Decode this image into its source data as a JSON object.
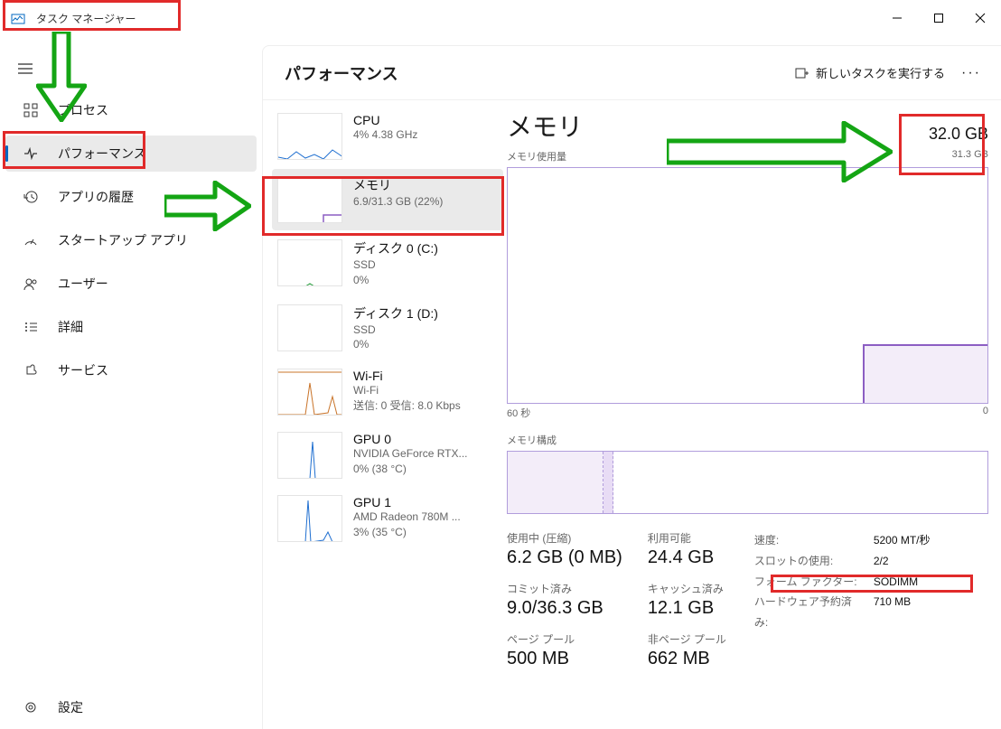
{
  "window": {
    "title": "タスク マネージャー"
  },
  "sidebar": {
    "items": [
      {
        "label": "プロセス"
      },
      {
        "label": "パフォーマンス"
      },
      {
        "label": "アプリの履歴"
      },
      {
        "label": "スタートアップ アプリ"
      },
      {
        "label": "ユーザー"
      },
      {
        "label": "詳細"
      },
      {
        "label": "サービス"
      }
    ],
    "settings": "設定"
  },
  "header": {
    "title": "パフォーマンス",
    "new_task": "新しいタスクを実行する"
  },
  "perf_list": {
    "cpu": {
      "title": "CPU",
      "sub1": "4%  4.38 GHz"
    },
    "memory": {
      "title": "メモリ",
      "sub1": "6.9/31.3 GB (22%)"
    },
    "disk0": {
      "title": "ディスク 0 (C:)",
      "sub1": "SSD",
      "sub2": "0%"
    },
    "disk1": {
      "title": "ディスク 1 (D:)",
      "sub1": "SSD",
      "sub2": "0%"
    },
    "wifi": {
      "title": "Wi-Fi",
      "sub1": "Wi-Fi",
      "sub2": "送信: 0 受信: 8.0 Kbps"
    },
    "gpu0": {
      "title": "GPU 0",
      "sub1": "NVIDIA GeForce RTX...",
      "sub2": "0% (38 °C)"
    },
    "gpu1": {
      "title": "GPU 1",
      "sub1": "AMD Radeon 780M ...",
      "sub2": "3% (35 °C)"
    }
  },
  "detail": {
    "title": "メモリ",
    "capacity": "32.0 GB",
    "usage_label": "メモリ使用量",
    "usage_max": "31.3 GB",
    "time_start": "60 秒",
    "time_end": "0",
    "composition_label": "メモリ構成",
    "stats": {
      "in_use_label": "使用中 (圧縮)",
      "in_use": "6.2 GB (0 MB)",
      "available_label": "利用可能",
      "available": "24.4 GB",
      "committed_label": "コミット済み",
      "committed": "9.0/36.3 GB",
      "cached_label": "キャッシュ済み",
      "cached": "12.1 GB",
      "paged_label": "ページ プール",
      "paged": "500 MB",
      "nonpaged_label": "非ページ プール",
      "nonpaged": "662 MB"
    },
    "specs": {
      "speed_k": "速度:",
      "speed_v": "5200 MT/秒",
      "slots_k": "スロットの使用:",
      "slots_v": "2/2",
      "form_k": "フォーム ファクター:",
      "form_v": "SODIMM",
      "reserved_k": "ハードウェア予約済み:",
      "reserved_v": "710 MB"
    }
  }
}
